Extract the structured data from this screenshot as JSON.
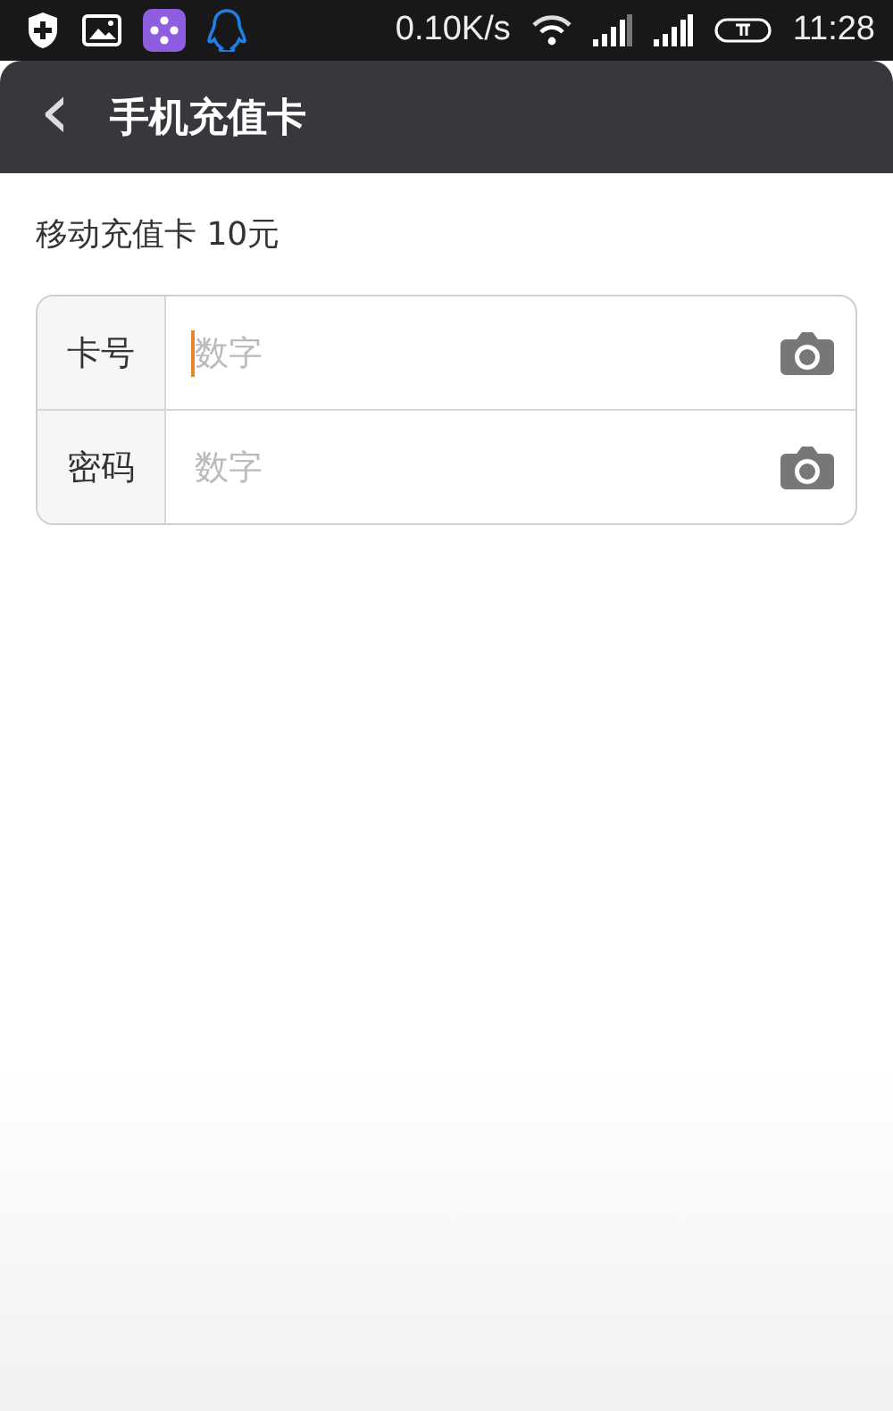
{
  "status_bar": {
    "speed": "0.10K/s",
    "time": "11:28"
  },
  "header": {
    "back": "‹",
    "title": "手机充值卡"
  },
  "card_title": "移动充值卡 10元",
  "fields": [
    {
      "label": "卡号",
      "placeholder": "数字",
      "focused": true
    },
    {
      "label": "密码",
      "placeholder": "数字",
      "focused": false
    }
  ]
}
